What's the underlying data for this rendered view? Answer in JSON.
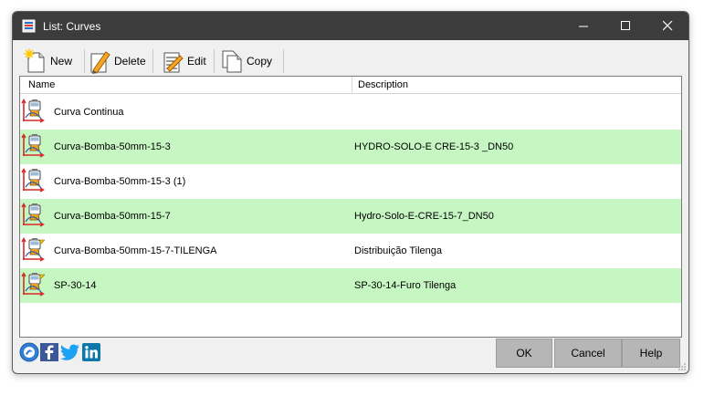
{
  "window": {
    "title": "List: Curves"
  },
  "toolbar": {
    "new_label": "New",
    "delete_label": "Delete",
    "edit_label": "Edit",
    "copy_label": "Copy"
  },
  "list": {
    "columns": [
      "Name",
      "Description"
    ],
    "rows": [
      {
        "name": "Curva Continua",
        "description": "",
        "icon": "pump-curve-icon",
        "highlighted": false,
        "flag": false
      },
      {
        "name": "Curva-Bomba-50mm-15-3",
        "description": "HYDRO-SOLO-E CRE-15-3 _DN50",
        "icon": "pump-curve-icon",
        "highlighted": true,
        "flag": false
      },
      {
        "name": "Curva-Bomba-50mm-15-3 (1)",
        "description": "",
        "icon": "pump-curve-icon",
        "highlighted": false,
        "flag": false
      },
      {
        "name": "Curva-Bomba-50mm-15-7",
        "description": "Hydro-Solo-E-CRE-15-7_DN50",
        "icon": "pump-curve-icon",
        "highlighted": true,
        "flag": false
      },
      {
        "name": "Curva-Bomba-50mm-15-7-TILENGA",
        "description": "Distribuição Tilenga",
        "icon": "pump-curve-flag-icon",
        "highlighted": false,
        "flag": true
      },
      {
        "name": "SP-30-14",
        "description": "SP-30-14-Furo Tilenga",
        "icon": "pump-curve-flag-icon",
        "highlighted": true,
        "flag": true
      }
    ]
  },
  "footer": {
    "ok_label": "OK",
    "cancel_label": "Cancel",
    "help_label": "Help",
    "social_icons": [
      "app-logo-icon",
      "facebook-icon",
      "twitter-icon",
      "linkedin-icon"
    ]
  },
  "colors": {
    "titlebar": "#3c3c3c",
    "row_highlight": "#c6f7c3",
    "button": "#b6b6b6"
  }
}
